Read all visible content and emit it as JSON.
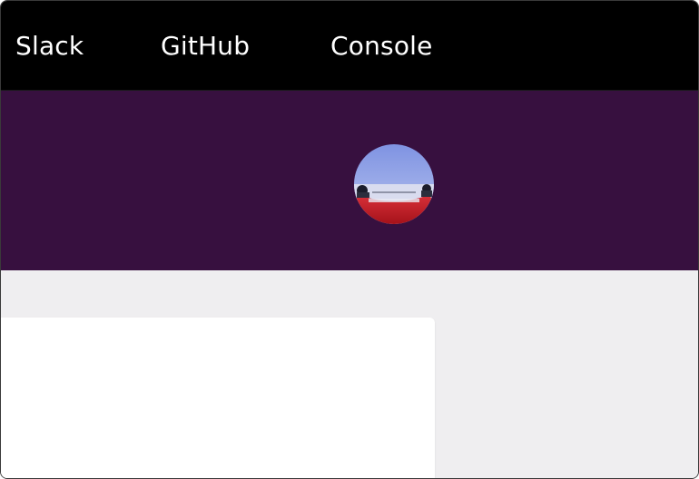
{
  "nav": {
    "links": [
      {
        "label": "Slack"
      },
      {
        "label": "GitHub"
      },
      {
        "label": "Console"
      }
    ]
  },
  "colors": {
    "nav_background": "#000000",
    "banner_background": "#37103f",
    "page_background": "#efeef0",
    "card_background": "#ffffff",
    "nav_text": "#ffffff"
  },
  "profile": {
    "avatar_icon": "user-avatar-photo"
  }
}
